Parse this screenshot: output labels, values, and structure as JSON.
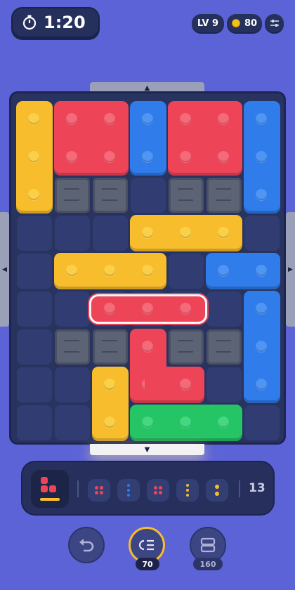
{
  "top_bar": {
    "timer": "1:20",
    "level": "LV 9",
    "coins": "80"
  },
  "board": {
    "rows": 9,
    "cols": 7,
    "walls": [
      [
        2,
        1
      ],
      [
        2,
        2
      ],
      [
        2,
        4
      ],
      [
        2,
        5
      ],
      [
        6,
        1
      ],
      [
        6,
        2
      ],
      [
        6,
        4
      ],
      [
        6,
        5
      ]
    ]
  },
  "queue": {
    "remaining_count": "13"
  },
  "bottom_buttons": {
    "undo_label": "",
    "sort_cost": "70",
    "layout_cost": "160"
  },
  "colors": {
    "background": "#5b63d6",
    "yellow": "#f8bd2c",
    "red": "#ee4458",
    "blue": "#2f7cea",
    "green": "#25c465",
    "wall": "#5c6375"
  },
  "icons": [
    "stopwatch-icon",
    "coin-icon",
    "settings-sliders-icon",
    "undo-icon",
    "sort-list-icon",
    "layout-grid-icon"
  ]
}
